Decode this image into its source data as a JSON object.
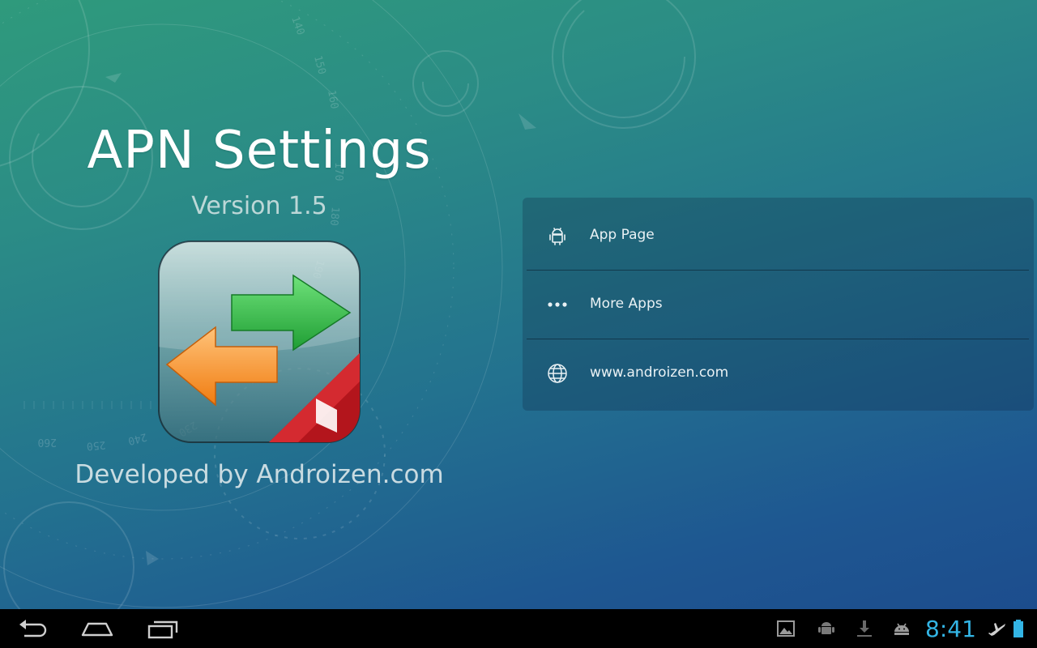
{
  "app": {
    "title": "APN Settings",
    "version": "Version 1.5",
    "developer": "Developed by Androizen.com"
  },
  "menu": {
    "items": [
      {
        "label": "App Page",
        "icon": "android-icon"
      },
      {
        "label": "More Apps",
        "icon": "more-dots-icon"
      },
      {
        "label": "www.androizen.com",
        "icon": "globe-icon"
      }
    ]
  },
  "dial_numbers": [
    "140",
    "150",
    "160",
    "170",
    "180",
    "190",
    "230",
    "240",
    "250",
    "260"
  ],
  "system_bar": {
    "nav": [
      "back-icon",
      "home-icon",
      "recent-apps-icon"
    ],
    "notifications": [
      "gallery-icon",
      "debug-icon",
      "download-icon",
      "android-notification-icon"
    ],
    "clock": "8:41",
    "status": [
      "airplane-mode-icon",
      "battery-icon"
    ]
  },
  "colors": {
    "clock": "#33b5e5",
    "arrow_green": "#35c24a",
    "arrow_orange": "#f7941d",
    "badge_red": "#c1272d"
  }
}
